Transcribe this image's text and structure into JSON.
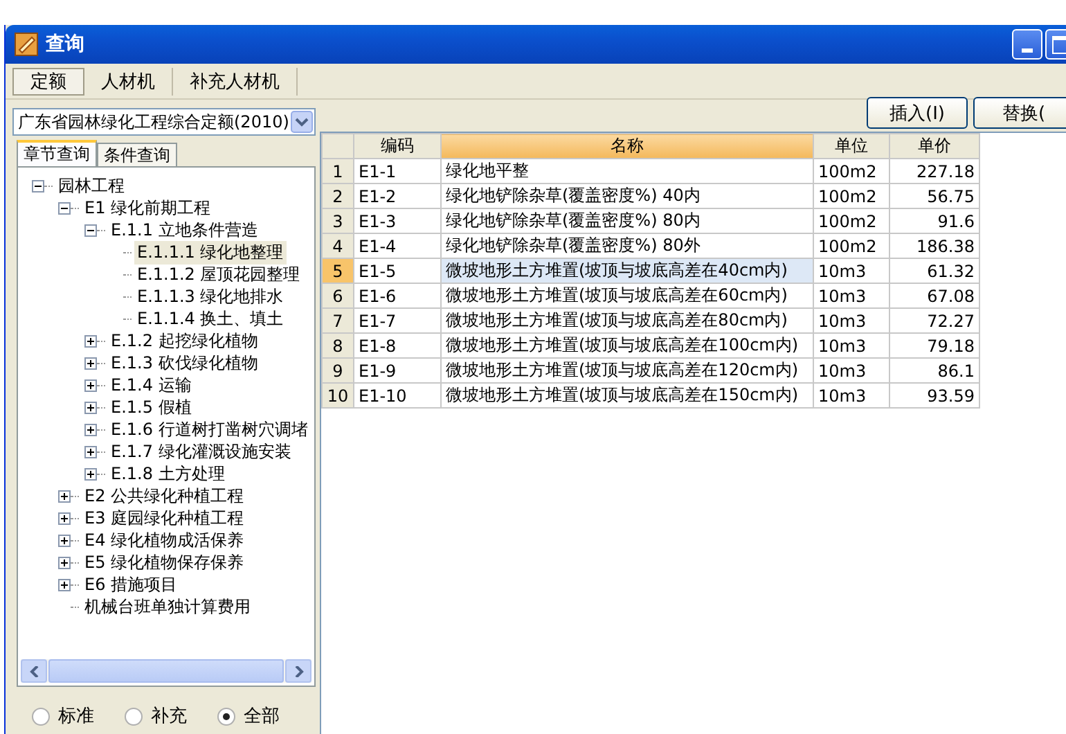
{
  "window": {
    "title": "查询"
  },
  "tabs": [
    {
      "label": "定额",
      "selected": true
    },
    {
      "label": "人材机",
      "selected": false
    },
    {
      "label": "补充人材机",
      "selected": false
    }
  ],
  "buttons": [
    {
      "label": "插入(I)"
    },
    {
      "label": "替换("
    }
  ],
  "left_panel": {
    "dropdown": {
      "value": "广东省园林绿化工程综合定额(2010)"
    },
    "subtabs": [
      {
        "label": "章节查询",
        "selected": true
      },
      {
        "label": "条件查询",
        "selected": false
      }
    ],
    "tree": [
      {
        "label": "园林工程",
        "expanded": true,
        "selected": false,
        "children": [
          {
            "label": "E1 绿化前期工程",
            "expanded": true,
            "selected": false,
            "children": [
              {
                "label": "E.1.1 立地条件营造",
                "expanded": true,
                "selected": false,
                "children": [
                  {
                    "label": "E.1.1.1 绿化地整理",
                    "selected": true
                  },
                  {
                    "label": "E.1.1.2 屋顶花园整理",
                    "selected": false
                  },
                  {
                    "label": "E.1.1.3 绿化地排水",
                    "selected": false
                  },
                  {
                    "label": "E.1.1.4 换土、填土",
                    "selected": false
                  }
                ]
              },
              {
                "label": "E.1.2 起挖绿化植物",
                "expanded": false,
                "selected": false
              },
              {
                "label": "E.1.3 砍伐绿化植物",
                "expanded": false,
                "selected": false
              },
              {
                "label": "E.1.4 运输",
                "expanded": false,
                "selected": false
              },
              {
                "label": "E.1.5 假植",
                "expanded": false,
                "selected": false
              },
              {
                "label": "E.1.6 行道树打凿树穴调堵",
                "expanded": false,
                "selected": false
              },
              {
                "label": "E.1.7 绿化灌溉设施安装",
                "expanded": false,
                "selected": false
              },
              {
                "label": "E.1.8 土方处理",
                "expanded": false,
                "selected": false
              }
            ]
          },
          {
            "label": "E2 公共绿化种植工程",
            "expanded": false,
            "selected": false
          },
          {
            "label": "E3 庭园绿化种植工程",
            "expanded": false,
            "selected": false
          },
          {
            "label": "E4 绿化植物成活保养",
            "expanded": false,
            "selected": false
          },
          {
            "label": "E5 绿化植物保存保养",
            "expanded": false,
            "selected": false
          },
          {
            "label": "E6 措施项目",
            "expanded": false,
            "selected": false
          },
          {
            "label": "机械台班单独计算费用",
            "selected": false
          }
        ]
      }
    ],
    "filters": [
      {
        "label": "标准",
        "selected": false
      },
      {
        "label": "补充",
        "selected": false
      },
      {
        "label": "全部",
        "selected": true
      }
    ]
  },
  "table": {
    "columns": [
      {
        "label": "编码",
        "active": false
      },
      {
        "label": "名称",
        "active": true
      },
      {
        "label": "单位",
        "active": false
      },
      {
        "label": "单价",
        "active": false
      }
    ],
    "rows": [
      {
        "number": "1",
        "code": "E1-1",
        "name": "绿化地平整",
        "unit": "100m2",
        "price": "227.18",
        "selected": false
      },
      {
        "number": "2",
        "code": "E1-2",
        "name": "绿化地铲除杂草(覆盖密度%)  40内",
        "unit": "100m2",
        "price": "56.75",
        "selected": false
      },
      {
        "number": "3",
        "code": "E1-3",
        "name": "绿化地铲除杂草(覆盖密度%)  80内",
        "unit": "100m2",
        "price": "91.6",
        "selected": false
      },
      {
        "number": "4",
        "code": "E1-4",
        "name": "绿化地铲除杂草(覆盖密度%)  80外",
        "unit": "100m2",
        "price": "186.38",
        "selected": false
      },
      {
        "number": "5",
        "code": "E1-5",
        "name": "微坡地形土方堆置(坡顶与坡底高差在40cm内)",
        "unit": "10m3",
        "price": "61.32",
        "selected": true
      },
      {
        "number": "6",
        "code": "E1-6",
        "name": "微坡地形土方堆置(坡顶与坡底高差在60cm内)",
        "unit": "10m3",
        "price": "67.08",
        "selected": false
      },
      {
        "number": "7",
        "code": "E1-7",
        "name": "微坡地形土方堆置(坡顶与坡底高差在80cm内)",
        "unit": "10m3",
        "price": "72.27",
        "selected": false
      },
      {
        "number": "8",
        "code": "E1-8",
        "name": "微坡地形土方堆置(坡顶与坡底高差在100cm内)",
        "unit": "10m3",
        "price": "79.18",
        "selected": false
      },
      {
        "number": "9",
        "code": "E1-9",
        "name": "微坡地形土方堆置(坡顶与坡底高差在120cm内)",
        "unit": "10m3",
        "price": "86.1",
        "selected": false
      },
      {
        "number": "10",
        "code": "E1-10",
        "name": "微坡地形土方堆置(坡顶与坡底高差在150cm内)",
        "unit": "10m3",
        "price": "93.59",
        "selected": false
      }
    ]
  }
}
